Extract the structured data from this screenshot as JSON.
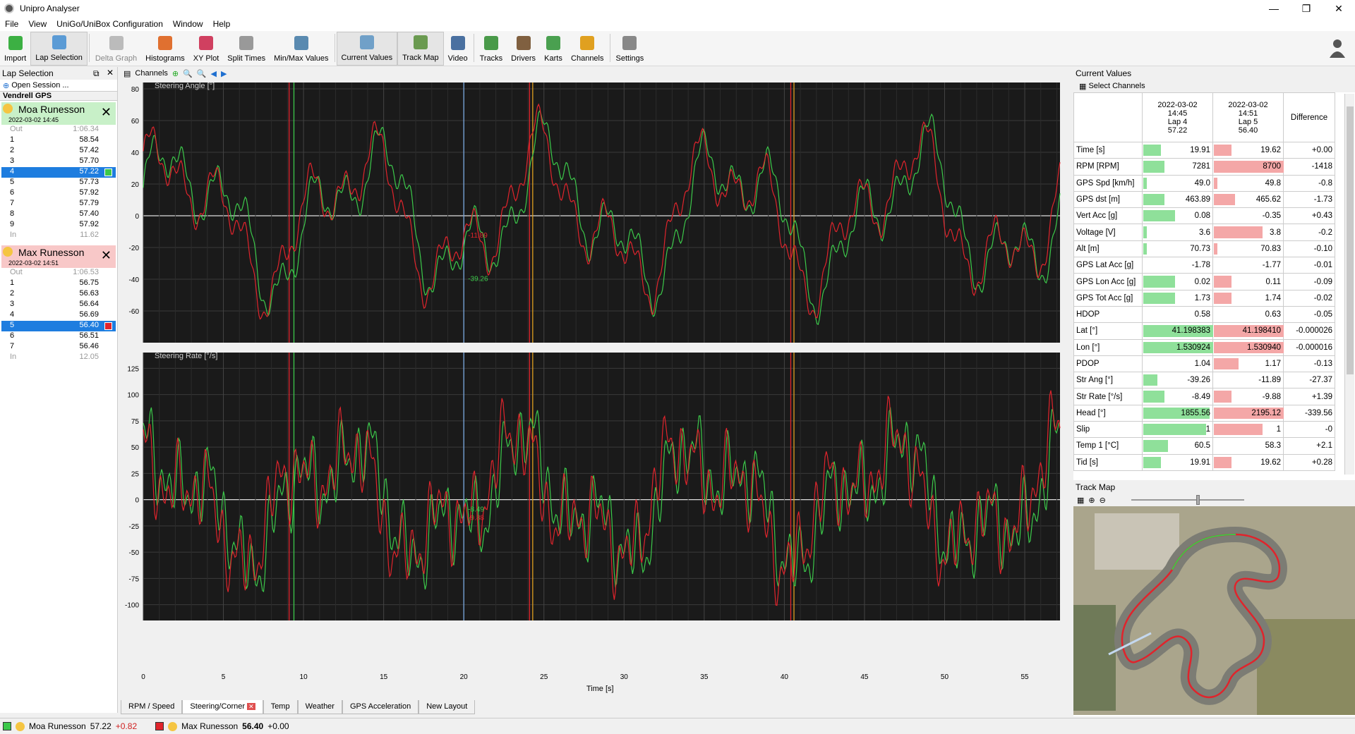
{
  "app": {
    "title": "Unipro Analyser"
  },
  "menu": [
    "File",
    "View",
    "UniGo/UniBox Configuration",
    "Window",
    "Help"
  ],
  "toolbar": [
    {
      "label": "Import",
      "icon": "import-icon"
    },
    {
      "label": "Lap Selection",
      "icon": "lap-selection-icon"
    },
    {
      "label": "Delta Graph",
      "icon": "delta-graph-icon"
    },
    {
      "label": "Histograms",
      "icon": "histogram-icon"
    },
    {
      "label": "XY Plot",
      "icon": "xy-plot-icon"
    },
    {
      "label": "Split Times",
      "icon": "split-times-icon"
    },
    {
      "label": "Min/Max Values",
      "icon": "minmax-icon"
    },
    {
      "label": "Current Values",
      "icon": "current-values-icon"
    },
    {
      "label": "Track Map",
      "icon": "track-map-icon"
    },
    {
      "label": "Video",
      "icon": "video-icon"
    },
    {
      "label": "Tracks",
      "icon": "tracks-icon"
    },
    {
      "label": "Drivers",
      "icon": "drivers-icon"
    },
    {
      "label": "Karts",
      "icon": "karts-icon"
    },
    {
      "label": "Channels",
      "icon": "channels-icon"
    },
    {
      "label": "Settings",
      "icon": "settings-icon"
    }
  ],
  "lap_selection": {
    "title": "Lap Selection",
    "open_session": "Open Session ...",
    "track": "Vendrell GPS",
    "drivers": [
      {
        "name": "Moa Runesson",
        "date": "2022-03-02 14:45",
        "color": "#3cc84a",
        "bg": "#c8f0c8",
        "laps": [
          [
            "Out",
            "1:06.34"
          ],
          [
            "1",
            "58.54"
          ],
          [
            "2",
            "57.42"
          ],
          [
            "3",
            "57.70"
          ],
          [
            "4",
            "57.22"
          ],
          [
            "5",
            "57.73"
          ],
          [
            "6",
            "57.92"
          ],
          [
            "7",
            "57.79"
          ],
          [
            "8",
            "57.40"
          ],
          [
            "9",
            "57.92"
          ],
          [
            "In",
            "11.62"
          ]
        ],
        "selected": 4
      },
      {
        "name": "Max Runesson",
        "date": "2022-03-02 14:51",
        "color": "#e0242c",
        "bg": "#f8c8c8",
        "laps": [
          [
            "Out",
            "1:06.53"
          ],
          [
            "1",
            "56.75"
          ],
          [
            "2",
            "56.63"
          ],
          [
            "3",
            "56.64"
          ],
          [
            "4",
            "56.69"
          ],
          [
            "5",
            "56.40"
          ],
          [
            "6",
            "56.51"
          ],
          [
            "7",
            "56.46"
          ],
          [
            "In",
            "12.05"
          ]
        ],
        "selected": 5
      }
    ]
  },
  "charts": {
    "channels_label": "Channels",
    "top": {
      "title": "Steering Angle [°]",
      "yticks": [
        "80",
        "60",
        "40",
        "20",
        "0",
        "-20",
        "-40",
        "-60"
      ],
      "marker_red": "-11.89",
      "marker_green": "-39.26"
    },
    "bottom": {
      "title": "Steering Rate [°/s]",
      "yticks": [
        "125",
        "100",
        "75",
        "50",
        "25",
        "0",
        "-25",
        "-50",
        "-75",
        "-100"
      ],
      "marker_green": "-8.49",
      "marker_red": "-9.88"
    },
    "xticks": [
      "0",
      "5",
      "10",
      "15",
      "20",
      "25",
      "30",
      "35",
      "40",
      "45",
      "50",
      "55"
    ],
    "xlabel": "Time [s]"
  },
  "tabs": [
    "RPM / Speed",
    "Steering/Corner",
    "Temp",
    "Weather",
    "GPS Acceleration",
    "New Layout"
  ],
  "current_values": {
    "title": "Current Values",
    "select": "Select Channels",
    "col1": [
      "2022-03-02",
      "14:45",
      "Lap 4",
      "57.22"
    ],
    "col2": [
      "2022-03-02",
      "14:51",
      "Lap 5",
      "56.40"
    ],
    "diff": "Difference",
    "rows": [
      [
        "Time [s]",
        "19.91",
        "19.62",
        "+0.00"
      ],
      [
        "RPM [RPM]",
        "7281",
        "8700",
        "-1418"
      ],
      [
        "GPS Spd [km/h]",
        "49.0",
        "49.8",
        "-0.8"
      ],
      [
        "GPS dst [m]",
        "463.89",
        "465.62",
        "-1.73"
      ],
      [
        "Vert Acc [g]",
        "0.08",
        "-0.35",
        "+0.43"
      ],
      [
        "Voltage [V]",
        "3.6",
        "3.8",
        "-0.2"
      ],
      [
        "Alt [m]",
        "70.73",
        "70.83",
        "-0.10"
      ],
      [
        "GPS Lat Acc [g]",
        "-1.78",
        "-1.77",
        "-0.01"
      ],
      [
        "GPS Lon Acc [g]",
        "0.02",
        "0.11",
        "-0.09"
      ],
      [
        "GPS Tot Acc [g]",
        "1.73",
        "1.74",
        "-0.02"
      ],
      [
        "HDOP",
        "0.58",
        "0.63",
        "-0.05"
      ],
      [
        "Lat [°]",
        "41.198383",
        "41.198410",
        "-0.000026"
      ],
      [
        "Lon [°]",
        "1.530924",
        "1.530940",
        "-0.000016"
      ],
      [
        "PDOP",
        "1.04",
        "1.17",
        "-0.13"
      ],
      [
        "Str Ang [°]",
        "-39.26",
        "-11.89",
        "-27.37"
      ],
      [
        "Str Rate [°/s]",
        "-8.49",
        "-9.88",
        "+1.39"
      ],
      [
        "Head [°]",
        "1855.56",
        "2195.12",
        "-339.56"
      ],
      [
        "Slip",
        "1",
        "1",
        "-0"
      ],
      [
        "Temp 1 [°C]",
        "60.5",
        "58.3",
        "+2.1"
      ],
      [
        "Tid [s]",
        "19.91",
        "19.62",
        "+0.28"
      ]
    ]
  },
  "track_map": {
    "title": "Track Map"
  },
  "status": {
    "d1": "Moa Runesson",
    "t1": "57.22",
    "g1": "+0.82",
    "d2": "Max Runesson",
    "t2": "56.40",
    "g2": "+0.00"
  }
}
